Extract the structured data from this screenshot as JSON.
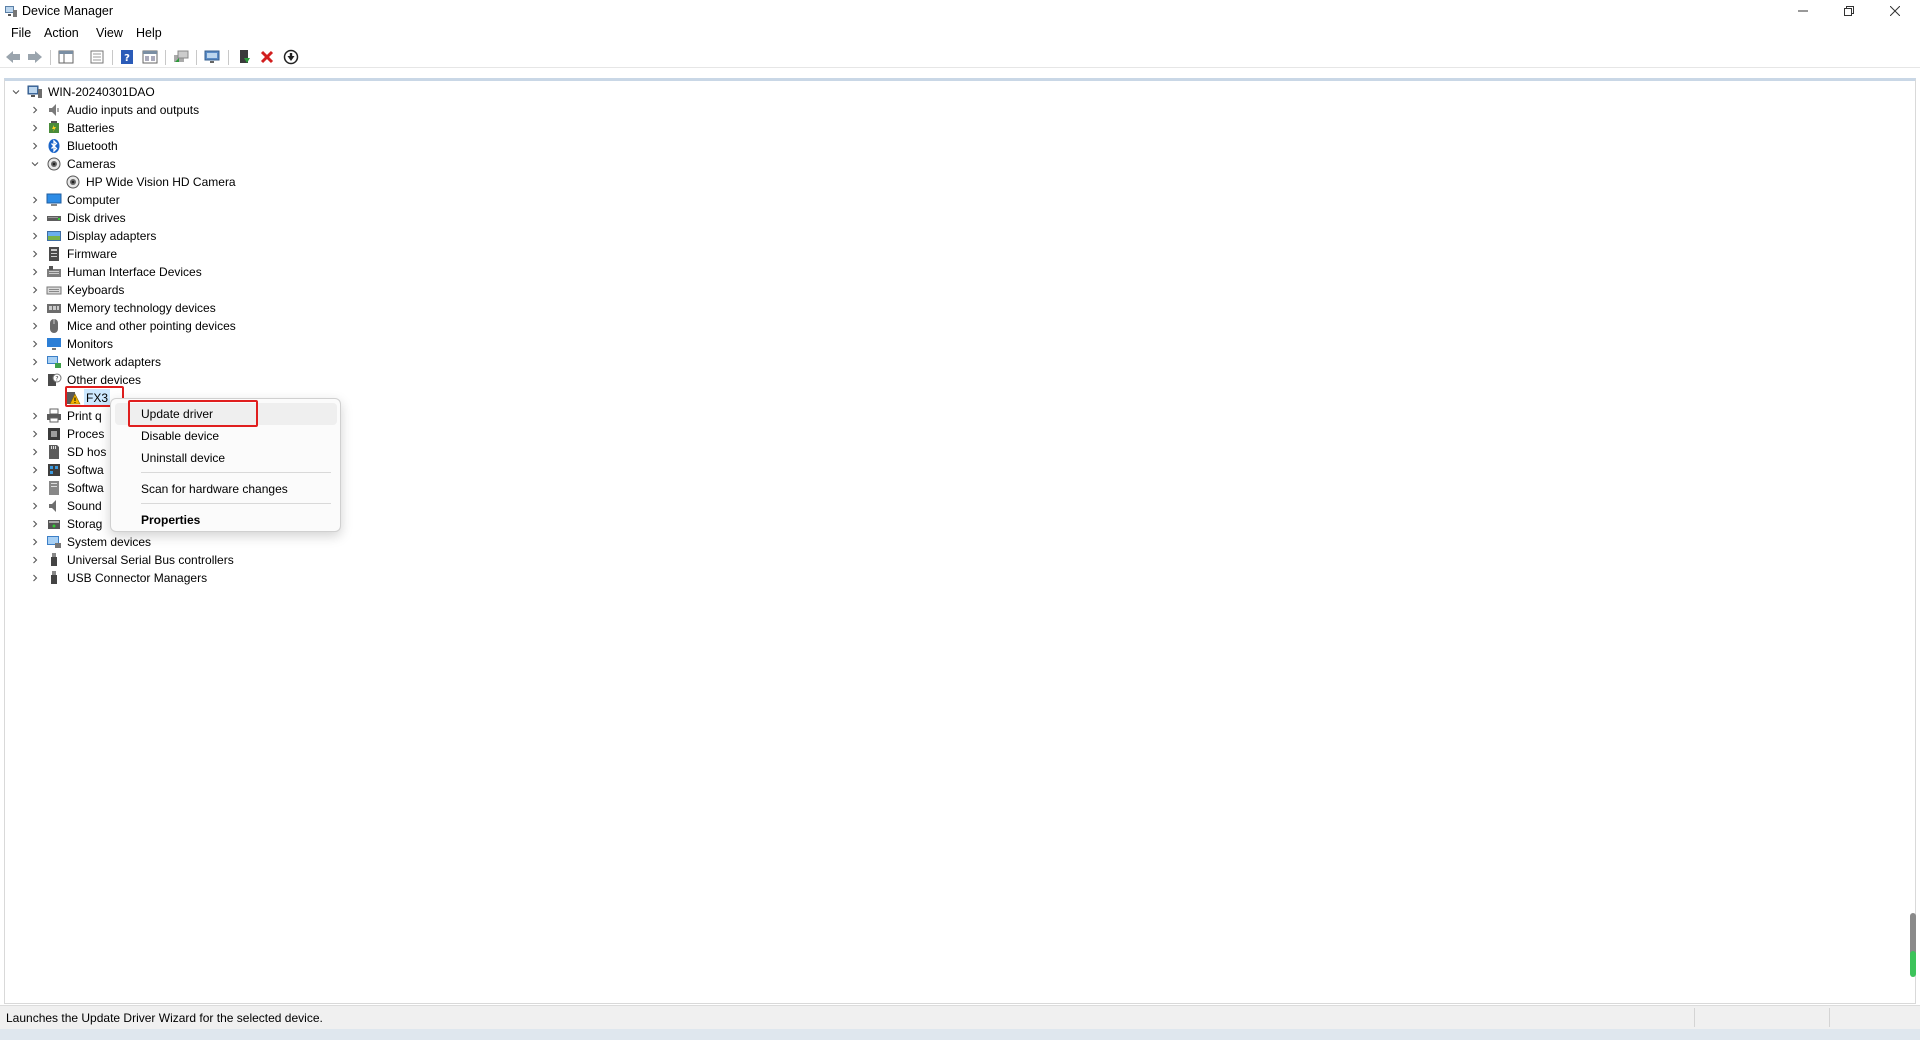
{
  "window": {
    "title": "Device Manager"
  },
  "menubar": {
    "items": [
      "File",
      "Action",
      "View",
      "Help"
    ]
  },
  "toolbar": {
    "buttons": [
      "back-icon",
      "forward-icon",
      "show-hide-tree-icon",
      "properties-icon",
      "help-icon",
      "resources-view-icon",
      "update-driver-software-icon",
      "scan-hardware-icon",
      "enable-device-icon",
      "uninstall-device-icon",
      "disable-device-icon"
    ]
  },
  "tree": {
    "root": "WIN-20240301DAO",
    "categories": [
      {
        "label": "Audio inputs and outputs",
        "icon": "speaker-icon",
        "expanded": false
      },
      {
        "label": "Batteries",
        "icon": "battery-icon",
        "expanded": false
      },
      {
        "label": "Bluetooth",
        "icon": "bluetooth-icon",
        "expanded": false
      },
      {
        "label": "Cameras",
        "icon": "camera-icon",
        "expanded": true
      },
      {
        "label": "HP Wide Vision HD Camera",
        "icon": "camera-icon",
        "child": true
      },
      {
        "label": "Computer",
        "icon": "computer-icon",
        "expanded": false
      },
      {
        "label": "Disk drives",
        "icon": "disk-icon",
        "expanded": false
      },
      {
        "label": "Display adapters",
        "icon": "display-icon",
        "expanded": false
      },
      {
        "label": "Firmware",
        "icon": "firmware-icon",
        "expanded": false
      },
      {
        "label": "Human Interface Devices",
        "icon": "hid-icon",
        "expanded": false
      },
      {
        "label": "Keyboards",
        "icon": "keyboard-icon",
        "expanded": false
      },
      {
        "label": "Memory technology devices",
        "icon": "memory-icon",
        "expanded": false
      },
      {
        "label": "Mice and other pointing devices",
        "icon": "mouse-icon",
        "expanded": false
      },
      {
        "label": "Monitors",
        "icon": "monitor-icon",
        "expanded": false
      },
      {
        "label": "Network adapters",
        "icon": "network-icon",
        "expanded": false
      },
      {
        "label": "Other devices",
        "icon": "other-devices-icon",
        "expanded": true
      },
      {
        "label": "FX3",
        "icon": "warning-device-icon",
        "child": true,
        "selected": true
      },
      {
        "label": "Print q",
        "icon": "printer-icon",
        "expanded": false
      },
      {
        "label": "Proces",
        "icon": "processor-icon",
        "expanded": false
      },
      {
        "label": "SD hos",
        "icon": "sd-host-icon",
        "expanded": false
      },
      {
        "label": "Softwa",
        "icon": "software-component-icon",
        "expanded": false
      },
      {
        "label": "Softwa",
        "icon": "software-device-icon",
        "expanded": false
      },
      {
        "label": "Sound",
        "icon": "sound-icon",
        "expanded": false
      },
      {
        "label": "Storag",
        "icon": "storage-icon",
        "expanded": false
      },
      {
        "label": "System devices",
        "icon": "system-devices-icon",
        "expanded": false
      },
      {
        "label": "Universal Serial Bus controllers",
        "icon": "usb-icon",
        "expanded": false
      },
      {
        "label": "USB Connector Managers",
        "icon": "usb-icon",
        "expanded": false
      }
    ]
  },
  "context_menu": {
    "items": [
      {
        "label": "Update driver",
        "highlighted": true
      },
      {
        "label": "Disable device"
      },
      {
        "label": "Uninstall device"
      },
      {
        "label": "Scan for hardware changes"
      },
      {
        "label": "Properties",
        "bold": true
      }
    ]
  },
  "status": {
    "text": "Launches the Update Driver Wizard for the selected device."
  },
  "colors": {
    "highlight_box": "#e01e1e",
    "selection": "#cce8ff",
    "warning": "#f2b200"
  }
}
